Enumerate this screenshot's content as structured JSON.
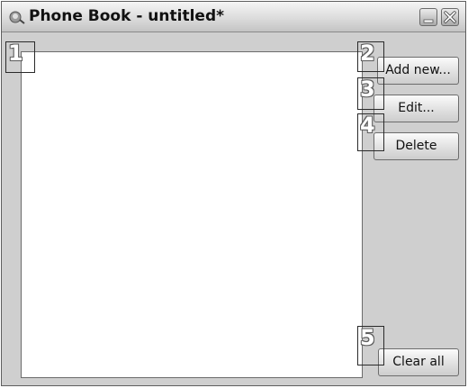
{
  "window": {
    "title": "Phone Book - untitled*",
    "icon": "phonebook-app-icon",
    "controls": {
      "minimize_icon": "minimize-icon",
      "close_icon": "close-icon"
    }
  },
  "buttons": {
    "add_new": "Add new...",
    "edit": "Edit...",
    "delete": "Delete",
    "clear_all": "Clear all"
  },
  "callouts": [
    "1",
    "2",
    "3",
    "4",
    "5"
  ],
  "colors": {
    "window_bg": "#cfcfcf",
    "list_bg": "#ffffff",
    "callout_text": "#ffffff",
    "border": "#6b6b6b"
  }
}
